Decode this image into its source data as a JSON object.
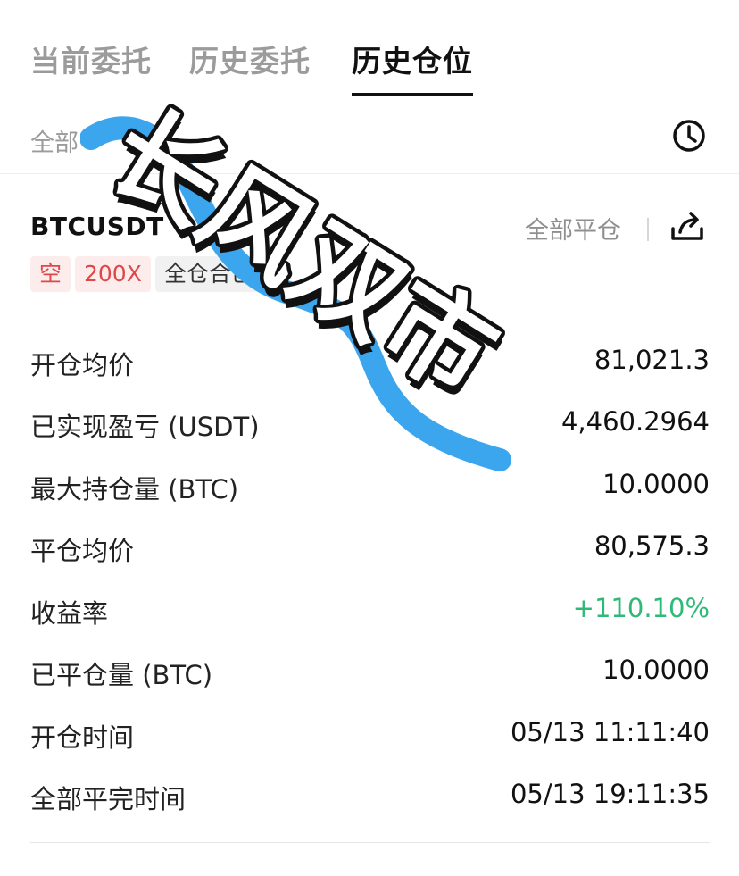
{
  "tabs": [
    {
      "label": "当前委托",
      "active": false
    },
    {
      "label": "历史委托",
      "active": false
    },
    {
      "label": "历史仓位",
      "active": true
    }
  ],
  "filters": [
    {
      "label": "全部"
    }
  ],
  "position": {
    "symbol": "BTCUSDT",
    "close_all_label": "全部平仓",
    "tags": [
      "空",
      "200X",
      "全仓合已"
    ]
  },
  "rows": [
    {
      "label": "开仓均价",
      "value": "81,021.3"
    },
    {
      "label": "已实现盈亏 (USDT)",
      "value": "4,460.2964"
    },
    {
      "label": "最大持仓量 (BTC)",
      "value": "10.0000"
    },
    {
      "label": "平仓均价",
      "value": "80,575.3"
    },
    {
      "label": "收益率",
      "value": "+110.10%"
    },
    {
      "label": "已平仓量 (BTC)",
      "value": "10.0000"
    },
    {
      "label": "开仓时间",
      "value": "05/13 11:11:40"
    },
    {
      "label": "全部平完时间",
      "value": "05/13 19:11:35"
    }
  ],
  "overlay": {
    "text": "长风双市"
  },
  "colors": {
    "profit_green": "#2fb978",
    "tag_red": "#e04848",
    "scribble_blue": "#3ba6ee"
  },
  "icons": {
    "history": "clock-icon",
    "share": "share-icon"
  }
}
